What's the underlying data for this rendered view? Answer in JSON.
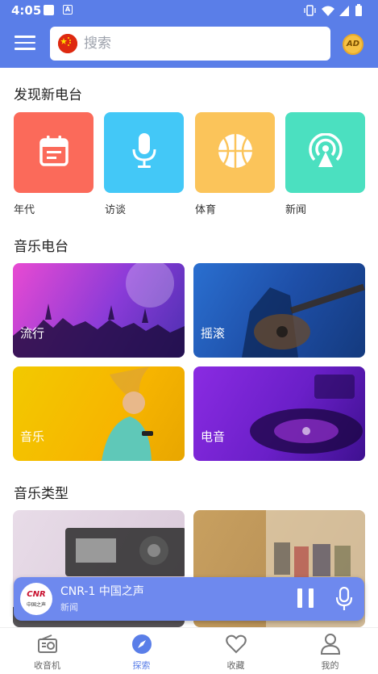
{
  "status_bar": {
    "time": "4:05",
    "notif_icon_letter": "A"
  },
  "search": {
    "placeholder": "搜索"
  },
  "ad_badge": "AD",
  "sections": {
    "discover": "发现新电台",
    "music_stations": "音乐电台",
    "music_types": "音乐类型"
  },
  "discover_items": [
    {
      "label": "年代",
      "icon": "calendar-icon",
      "color": "#fb6a5a"
    },
    {
      "label": "访谈",
      "icon": "microphone-icon",
      "color": "#43c8f7"
    },
    {
      "label": "体育",
      "icon": "basketball-icon",
      "color": "#fbc45a"
    },
    {
      "label": "新闻",
      "icon": "broadcast-icon",
      "color": "#4be0c0"
    }
  ],
  "music_cards": [
    {
      "label": "流行"
    },
    {
      "label": "摇滚"
    },
    {
      "label": "音乐"
    },
    {
      "label": "电音"
    }
  ],
  "player": {
    "logo_text": "CNR",
    "logo_sub": "中国之声",
    "title": "CNR-1 中国之声",
    "subtitle": "新闻"
  },
  "nav": [
    {
      "label": "收音机",
      "icon": "radio-icon"
    },
    {
      "label": "探索",
      "icon": "compass-icon",
      "active": true
    },
    {
      "label": "收藏",
      "icon": "heart-icon"
    },
    {
      "label": "我的",
      "icon": "user-icon"
    }
  ],
  "colors": {
    "primary": "#5a7ee8",
    "player": "#6e89ee"
  }
}
